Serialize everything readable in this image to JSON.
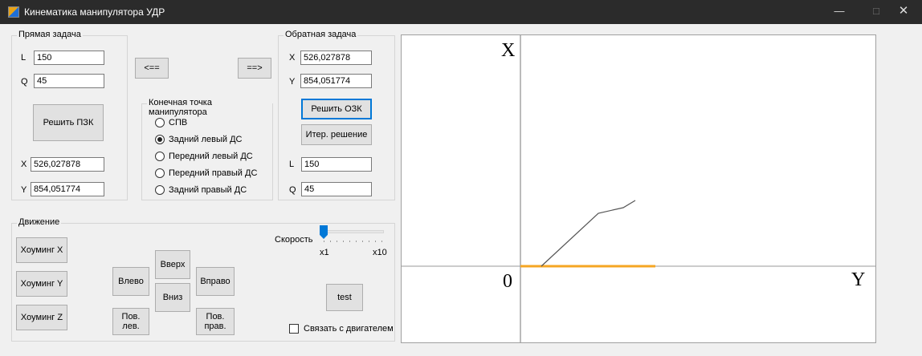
{
  "window": {
    "title": "Кинематика манипулятора УДР",
    "minimize": "—",
    "maximize": "□",
    "close": "✕"
  },
  "direct": {
    "caption": "Прямая задача",
    "l_label": "L",
    "l_value": "150",
    "q_label": "Q",
    "q_value": "45",
    "solve_button": "Решить ПЗК",
    "x_label": "X",
    "x_value": "526,027878",
    "y_label": "Y",
    "y_value": "854,051774"
  },
  "transfer": {
    "left_button": "<==",
    "right_button": "==>"
  },
  "endpoint": {
    "caption": "Конечная точка манипулятора",
    "options": [
      {
        "label": "СПВ",
        "checked": false
      },
      {
        "label": "Задний левый ДС",
        "checked": true
      },
      {
        "label": "Передний левый ДС",
        "checked": false
      },
      {
        "label": "Передний правый ДС",
        "checked": false
      },
      {
        "label": "Задний правый ДС",
        "checked": false
      }
    ]
  },
  "inverse": {
    "caption": "Обратная задача",
    "x_label": "X",
    "x_value": "526,027878",
    "y_label": "Y",
    "y_value": "854,051774",
    "solve_button": "Решить ОЗК",
    "iter_button": "Итер. решение",
    "l_label": "L",
    "l_value": "150",
    "q_label": "Q",
    "q_value": "45"
  },
  "motion": {
    "caption": "Движение",
    "homing_x": "Хоуминг X",
    "homing_y": "Хоуминг Y",
    "homing_z": "Хоуминг Z",
    "left": "Влево",
    "up": "Вверх",
    "down": "Вниз",
    "right": "Вправо",
    "rot_left": "Пов.\nлев.",
    "rot_right": "Пов.\nправ.",
    "speed_label": "Скорость",
    "speed_min": "x1",
    "speed_max": "x10",
    "speed_level": 0,
    "test_button": "test",
    "link_engine": "Связать с двигателем",
    "link_engine_checked": false
  },
  "plot": {
    "x_axis_label": "X",
    "y_axis_label": "Y",
    "origin_label": "0",
    "accent_color": "#f5a623",
    "arm_color": "#555555"
  }
}
